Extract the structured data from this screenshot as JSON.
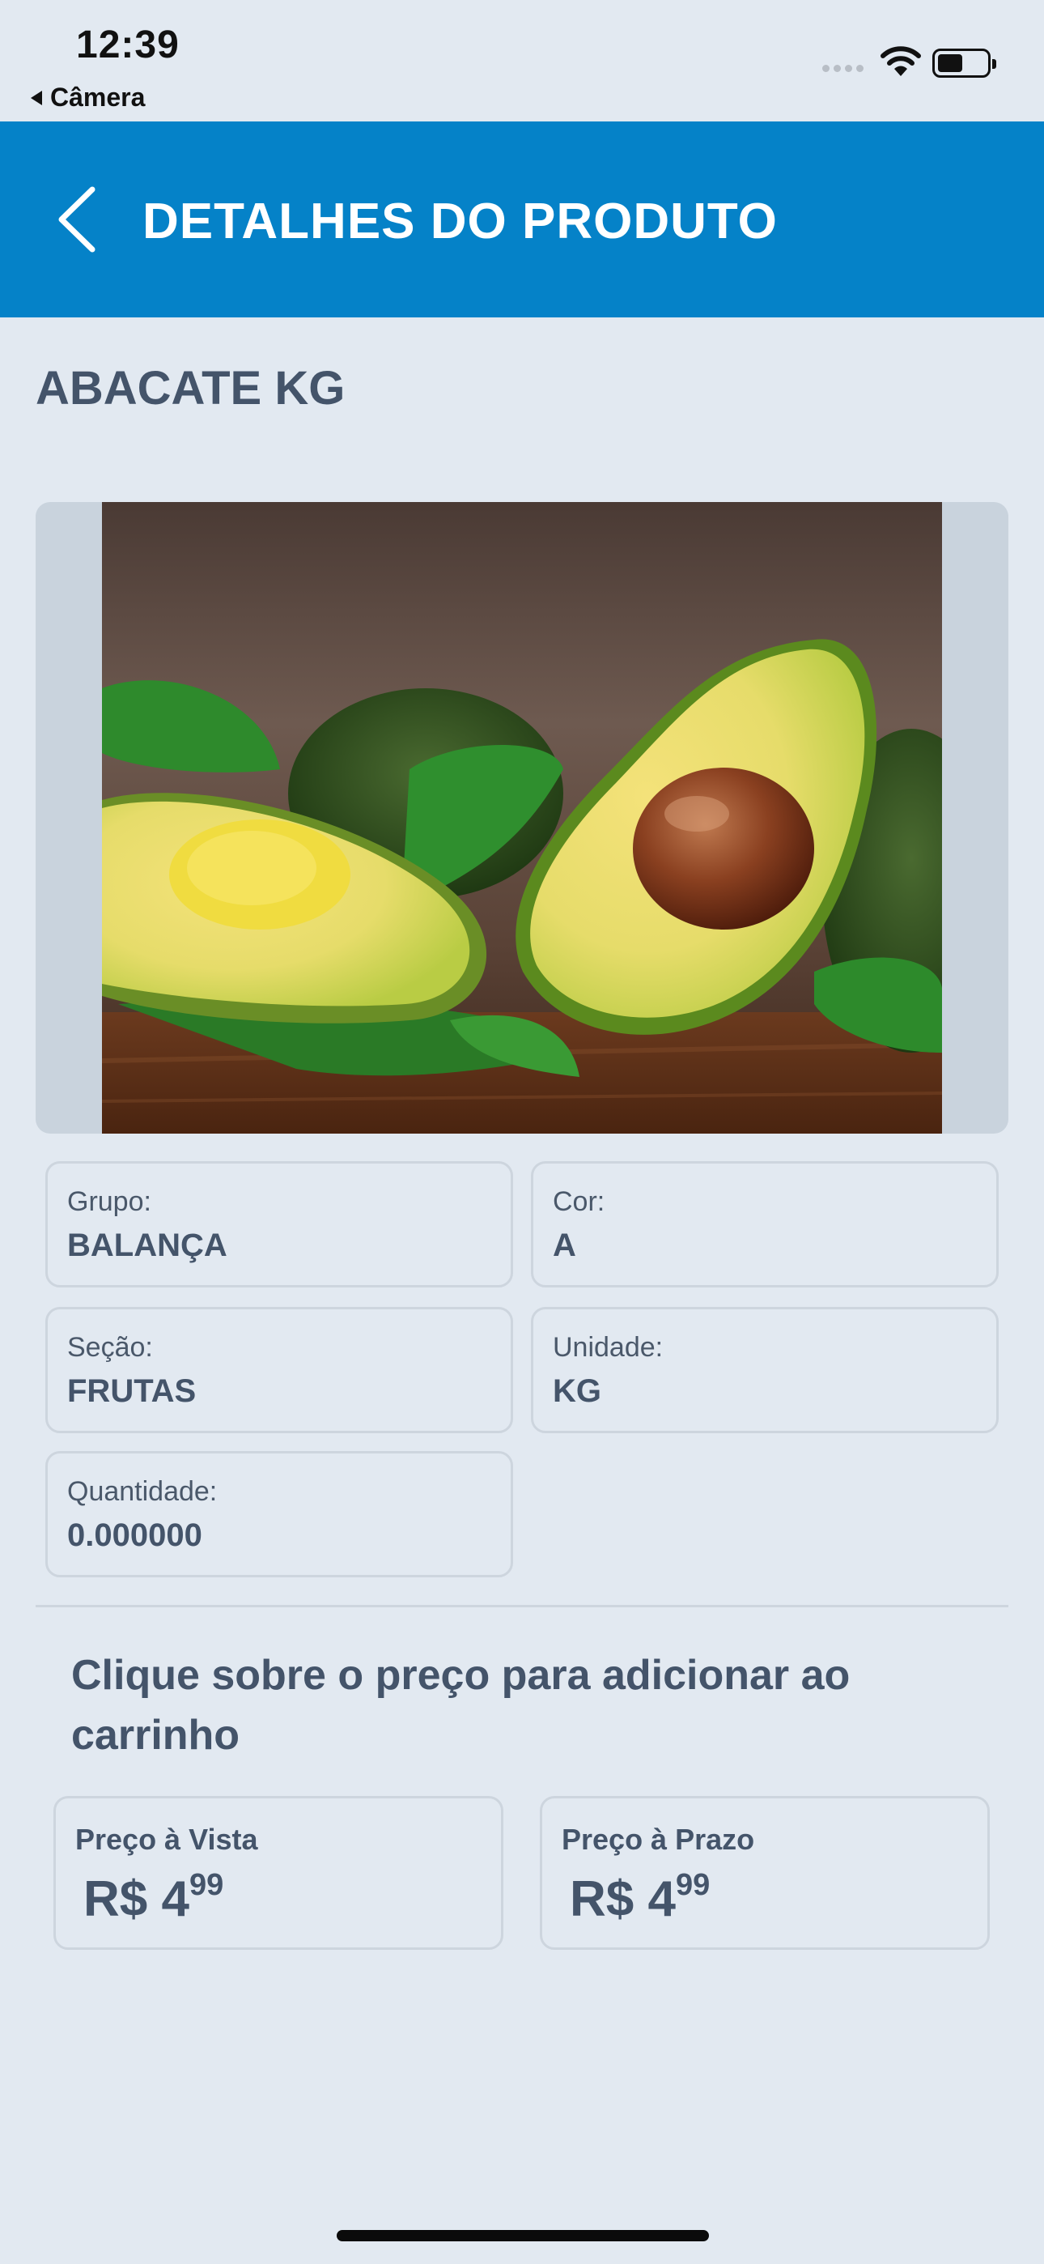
{
  "status_bar": {
    "time": "12:39",
    "back_app_label": "Câmera"
  },
  "header": {
    "title": "DETALHES DO PRODUTO",
    "color": "#0582c8"
  },
  "product": {
    "name": "ABACATE KG",
    "image_subject": "avocado-halves-photo"
  },
  "details": {
    "grupo": {
      "label": "Grupo:",
      "value": "BALANÇA"
    },
    "cor": {
      "label": "Cor:",
      "value": "A"
    },
    "secao": {
      "label": "Seção:",
      "value": "FRUTAS"
    },
    "unidade": {
      "label": "Unidade:",
      "value": "KG"
    },
    "quantidade": {
      "label": "Quantidade:",
      "value": "0.000000"
    }
  },
  "instruction": "Clique sobre o preço para adicionar ao carrinho",
  "prices": {
    "vista": {
      "label": "Preço à Vista",
      "main": "R$ 4",
      "cents": "99"
    },
    "prazo": {
      "label": "Preço à Prazo",
      "main": "R$ 4",
      "cents": "99"
    }
  }
}
